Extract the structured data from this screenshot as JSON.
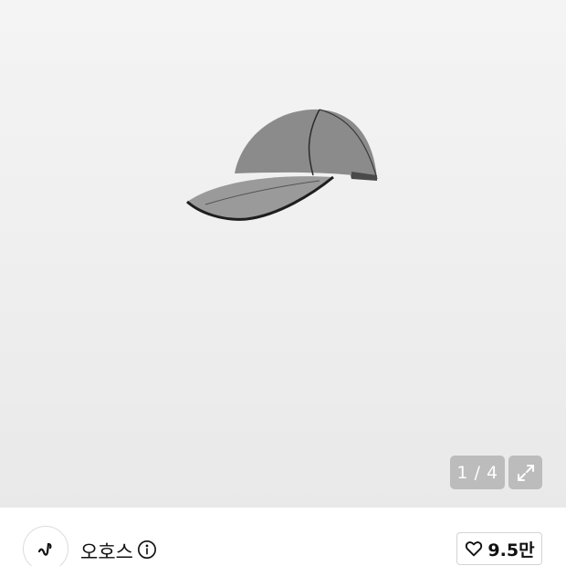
{
  "gallery": {
    "image_alt": "",
    "current_index": "1",
    "separator": "/",
    "total": "4",
    "counter_text": "1 / 4",
    "expand_icon": "expand-icon"
  },
  "brand": {
    "name": "오호스",
    "logo_icon": "brand-logo-icon",
    "info_icon": "info-icon"
  },
  "like": {
    "icon": "heart-outline-icon",
    "count": "9.5만"
  }
}
